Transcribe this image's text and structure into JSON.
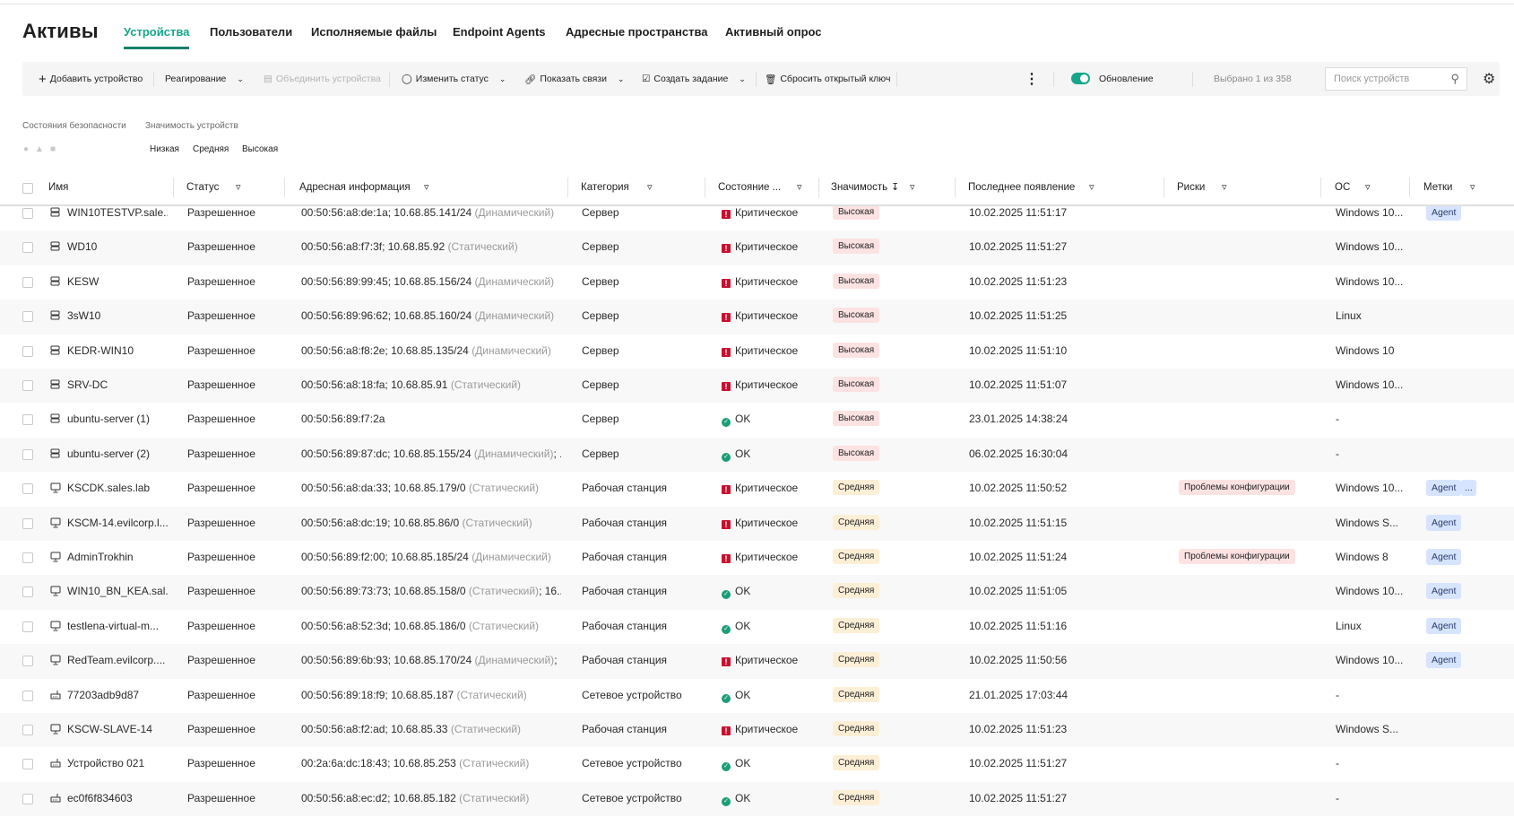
{
  "page": {
    "title": "Активы"
  },
  "tabs": [
    {
      "label": "Устройства",
      "active": true
    },
    {
      "label": "Пользователи"
    },
    {
      "label": "Исполняемые файлы"
    },
    {
      "label": "Endpoint Agents"
    },
    {
      "label": "Адресные пространства"
    },
    {
      "label": "Активный опрос"
    }
  ],
  "toolbar": {
    "add": "Добавить устройство",
    "response": "Реагирование",
    "merge": "Объединить устройства",
    "change_status": "Изменить статус",
    "show_links": "Показать связи",
    "create_task": "Создать задание",
    "reset_key": "Сбросить открытый ключ",
    "update_label": "Обновление",
    "update_on": true,
    "selected": "Выбрано 1 из 358",
    "search_placeholder": "Поиск устройств"
  },
  "filters": {
    "security_label": "Состояния безопасности",
    "significance_label": "Значимость устройств",
    "significance_options": [
      "Низкая",
      "Средняя",
      "Высокая"
    ]
  },
  "columns": {
    "name": "Имя",
    "status": "Статус",
    "address": "Адресная информация",
    "category": "Категория",
    "state": "Состояние ...",
    "significance": "Значимость",
    "last_seen": "Последнее появление",
    "risks": "Риски",
    "os": "ОС",
    "tags": "Метки"
  },
  "colors": {
    "accent": "#17a689",
    "critical": "#c8102e",
    "ok": "#1a9e77"
  },
  "rows": [
    {
      "type": "server",
      "name": "WIN10TESTVP.sale...",
      "status": "Разрешенное",
      "addr": "00:50:56:a8:de:1a; 10.68.85.141/24",
      "addr_type": "(Динамический)",
      "addr_more": "",
      "category": "Сервер",
      "state": "critical",
      "state_label": "Критическое",
      "sig": "high",
      "sig_label": "Высокая",
      "seen": "10.02.2025 11:51:17",
      "risk": "",
      "os": "Windows 10...",
      "tags": [
        "Agent"
      ]
    },
    {
      "type": "server",
      "name": "WD10",
      "status": "Разрешенное",
      "addr": "00:50:56:a8:f7:3f; 10.68.85.92",
      "addr_type": "(Статический)",
      "addr_more": "",
      "category": "Сервер",
      "state": "critical",
      "state_label": "Критическое",
      "sig": "high",
      "sig_label": "Высокая",
      "seen": "10.02.2025 11:51:27",
      "risk": "",
      "os": "Windows 10...",
      "tags": []
    },
    {
      "type": "server",
      "name": "KESW",
      "status": "Разрешенное",
      "addr": "00:50:56:89:99:45; 10.68.85.156/24",
      "addr_type": "(Динамический)",
      "addr_more": "",
      "category": "Сервер",
      "state": "critical",
      "state_label": "Критическое",
      "sig": "high",
      "sig_label": "Высокая",
      "seen": "10.02.2025 11:51:23",
      "risk": "",
      "os": "Windows 10...",
      "tags": []
    },
    {
      "type": "server",
      "name": "3sW10",
      "status": "Разрешенное",
      "addr": "00:50:56:89:96:62; 10.68.85.160/24",
      "addr_type": "(Динамический)",
      "addr_more": "",
      "category": "Сервер",
      "state": "critical",
      "state_label": "Критическое",
      "sig": "high",
      "sig_label": "Высокая",
      "seen": "10.02.2025 11:51:25",
      "risk": "",
      "os": "Linux",
      "tags": []
    },
    {
      "type": "server",
      "name": "KEDR-WIN10",
      "status": "Разрешенное",
      "addr": "00:50:56:a8:f8:2e; 10.68.85.135/24",
      "addr_type": "(Динамический)",
      "addr_more": "",
      "category": "Сервер",
      "state": "critical",
      "state_label": "Критическое",
      "sig": "high",
      "sig_label": "Высокая",
      "seen": "10.02.2025 11:51:10",
      "risk": "",
      "os": "Windows 10",
      "tags": []
    },
    {
      "type": "server",
      "name": "SRV-DC",
      "status": "Разрешенное",
      "addr": "00:50:56:a8:18:fa; 10.68.85.91",
      "addr_type": "(Статический)",
      "addr_more": "",
      "category": "Сервер",
      "state": "critical",
      "state_label": "Критическое",
      "sig": "high",
      "sig_label": "Высокая",
      "seen": "10.02.2025 11:51:07",
      "risk": "",
      "os": "Windows 10...",
      "tags": []
    },
    {
      "type": "server",
      "name": "ubuntu-server (1)",
      "status": "Разрешенное",
      "addr": "00:50:56:89:f7:2a",
      "addr_type": "",
      "addr_more": "",
      "category": "Сервер",
      "state": "ok",
      "state_label": "OK",
      "sig": "high",
      "sig_label": "Высокая",
      "seen": "23.01.2025 14:38:24",
      "risk": "",
      "os": "-",
      "tags": []
    },
    {
      "type": "server",
      "name": "ubuntu-server (2)",
      "status": "Разрешенное",
      "addr": "00:50:56:89:87:dc; 10.68.85.155/24",
      "addr_type": "(Динамический)",
      "addr_more": "; ...",
      "category": "Сервер",
      "state": "ok",
      "state_label": "OK",
      "sig": "high",
      "sig_label": "Высокая",
      "seen": "06.02.2025 16:30:04",
      "risk": "",
      "os": "-",
      "tags": []
    },
    {
      "type": "workstation",
      "name": "KSCDK.sales.lab",
      "status": "Разрешенное",
      "addr": "00:50:56:a8:da:33; 10.68.85.179/0",
      "addr_type": "(Статический)",
      "addr_more": "",
      "category": "Рабочая станция",
      "state": "critical",
      "state_label": "Критическое",
      "sig": "mid",
      "sig_label": "Средняя",
      "seen": "10.02.2025 11:50:52",
      "risk": "Проблемы конфигурации",
      "os": "Windows 10...",
      "tags": [
        "Agent",
        "..."
      ]
    },
    {
      "type": "workstation",
      "name": "KSCM-14.evilcorp.l...",
      "status": "Разрешенное",
      "addr": "00:50:56:a8:dc:19; 10.68.85.86/0",
      "addr_type": "(Статический)",
      "addr_more": "",
      "category": "Рабочая станция",
      "state": "critical",
      "state_label": "Критическое",
      "sig": "mid",
      "sig_label": "Средняя",
      "seen": "10.02.2025 11:51:15",
      "risk": "",
      "os": "Windows S...",
      "tags": [
        "Agent"
      ]
    },
    {
      "type": "workstation",
      "name": "AdminTrokhin",
      "status": "Разрешенное",
      "addr": "00:50:56:89:f2:00; 10.68.85.185/24",
      "addr_type": "(Динамический)",
      "addr_more": "",
      "category": "Рабочая станция",
      "state": "critical",
      "state_label": "Критическое",
      "sig": "mid",
      "sig_label": "Средняя",
      "seen": "10.02.2025 11:51:24",
      "risk": "Проблемы конфигурации",
      "os": "Windows 8",
      "tags": [
        "Agent"
      ]
    },
    {
      "type": "workstation",
      "name": "WIN10_BN_KEA.sal...",
      "status": "Разрешенное",
      "addr": "00:50:56:89:73:73; 10.68.85.158/0",
      "addr_type": "(Статический)",
      "addr_more": "; 16...",
      "category": "Рабочая станция",
      "state": "ok",
      "state_label": "OK",
      "sig": "mid",
      "sig_label": "Средняя",
      "seen": "10.02.2025 11:51:05",
      "risk": "",
      "os": "Windows 10...",
      "tags": [
        "Agent"
      ]
    },
    {
      "type": "workstation",
      "name": "testlena-virtual-m...",
      "status": "Разрешенное",
      "addr": "00:50:56:a8:52:3d; 10.68.85.186/0",
      "addr_type": "(Статический)",
      "addr_more": "",
      "category": "Рабочая станция",
      "state": "ok",
      "state_label": "OK",
      "sig": "mid",
      "sig_label": "Средняя",
      "seen": "10.02.2025 11:51:16",
      "risk": "",
      "os": "Linux",
      "tags": [
        "Agent"
      ]
    },
    {
      "type": "workstation",
      "name": "RedTeam.evilcorp....",
      "status": "Разрешенное",
      "addr": "00:50:56:89:6b:93; 10.68.85.170/24",
      "addr_type": "(Динамический)",
      "addr_more": "; ...",
      "category": "Рабочая станция",
      "state": "critical",
      "state_label": "Критическое",
      "sig": "mid",
      "sig_label": "Средняя",
      "seen": "10.02.2025 11:50:56",
      "risk": "",
      "os": "Windows 10...",
      "tags": [
        "Agent"
      ]
    },
    {
      "type": "network",
      "name": "77203adb9d87",
      "status": "Разрешенное",
      "addr": "00:50:56:89:18:f9; 10.68.85.187",
      "addr_type": "(Статический)",
      "addr_more": "",
      "category": "Сетевое устройство",
      "state": "ok",
      "state_label": "OK",
      "sig": "mid",
      "sig_label": "Средняя",
      "seen": "21.01.2025 17:03:44",
      "risk": "",
      "os": "-",
      "tags": []
    },
    {
      "type": "workstation",
      "name": "KSCW-SLAVE-14",
      "status": "Разрешенное",
      "addr": "00:50:56:a8:f2:ad; 10.68.85.33",
      "addr_type": "(Статический)",
      "addr_more": "",
      "category": "Рабочая станция",
      "state": "critical",
      "state_label": "Критическое",
      "sig": "mid",
      "sig_label": "Средняя",
      "seen": "10.02.2025 11:51:23",
      "risk": "",
      "os": "Windows S...",
      "tags": []
    },
    {
      "type": "network",
      "name": "Устройство 021",
      "status": "Разрешенное",
      "addr": "00:2a:6a:dc:18:43; 10.68.85.253",
      "addr_type": "(Статический)",
      "addr_more": "",
      "category": "Сетевое устройство",
      "state": "ok",
      "state_label": "OK",
      "sig": "mid",
      "sig_label": "Средняя",
      "seen": "10.02.2025 11:51:27",
      "risk": "",
      "os": "-",
      "tags": []
    },
    {
      "type": "network",
      "name": "ec0f6f834603",
      "status": "Разрешенное",
      "addr": "00:50:56:a8:ec:d2; 10.68.85.182",
      "addr_type": "(Статический)",
      "addr_more": "",
      "category": "Сетевое устройство",
      "state": "ok",
      "state_label": "OK",
      "sig": "mid",
      "sig_label": "Средняя",
      "seen": "10.02.2025 11:51:27",
      "risk": "",
      "os": "-",
      "tags": []
    }
  ]
}
